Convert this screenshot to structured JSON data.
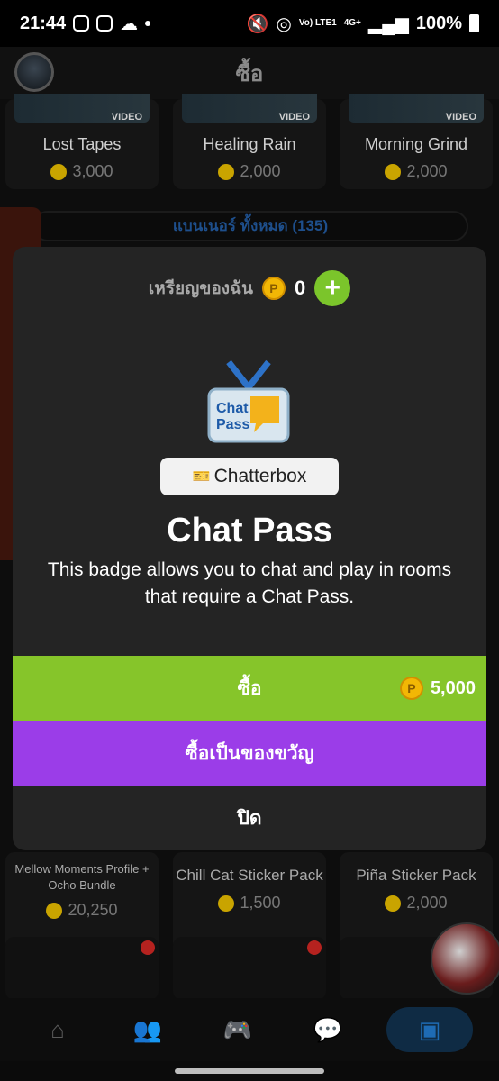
{
  "status_bar": {
    "time": "21:44",
    "network": "4G+",
    "lte": "Vo) LTE1",
    "battery": "100%"
  },
  "header": {
    "title": "ซื้อ"
  },
  "store": {
    "top_cards": [
      {
        "title": "Lost Tapes",
        "price": "3,000",
        "tag": "VIDEO"
      },
      {
        "title": "Healing Rain",
        "price": "2,000",
        "tag": "VIDEO"
      },
      {
        "title": "Morning Grind",
        "price": "2,000",
        "tag": "VIDEO"
      }
    ],
    "banners_link": "แบนเนอร์ ทั้งหมด (135)",
    "bottom_cards": [
      {
        "title": "Mellow Moments Profile + Ocho Bundle",
        "price": "20,250"
      },
      {
        "title": "Chill Cat Sticker Pack",
        "price": "1,500"
      },
      {
        "title": "Piña Sticker Pack",
        "price": "2,000"
      }
    ]
  },
  "modal": {
    "coins_label": "เหรียญของฉัน",
    "coins_value": "0",
    "add_icon": "plus-icon",
    "pill_label": "Chatterbox",
    "title": "Chat Pass",
    "description": "This badge allows you to chat and play in rooms that require a Chat Pass.",
    "buy_label": "ซื้อ",
    "buy_price": "5,000",
    "gift_label": "ซื้อเป็นของขวัญ",
    "close_label": "ปิด"
  },
  "bottom_nav": {
    "items": [
      "home-icon",
      "friends-icon",
      "games-icon",
      "chat-icon",
      "shop-icon"
    ],
    "active": "shop-icon"
  },
  "colors": {
    "buy": "#86c52a",
    "gift": "#9b3de8",
    "coin": "#f2b705",
    "modal_bg": "#242424"
  }
}
